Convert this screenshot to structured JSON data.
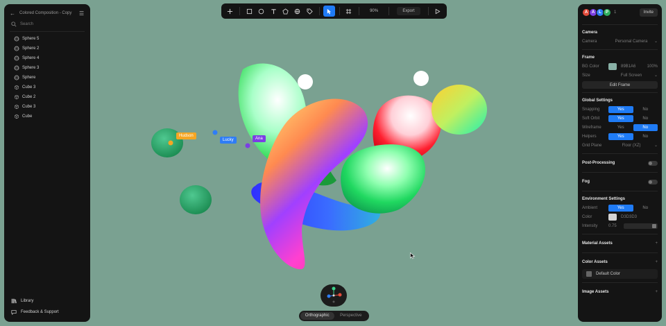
{
  "project": {
    "title": "Colored Composition - Copy"
  },
  "search": {
    "placeholder": "Search"
  },
  "layers": [
    {
      "name": "Sphere 5",
      "kind": "sphere"
    },
    {
      "name": "Sphere 2",
      "kind": "sphere"
    },
    {
      "name": "Sphere 4",
      "kind": "sphere"
    },
    {
      "name": "Sphere 3",
      "kind": "sphere"
    },
    {
      "name": "Sphere",
      "kind": "sphere"
    },
    {
      "name": "Cube 3",
      "kind": "cube"
    },
    {
      "name": "Cube 2",
      "kind": "cube"
    },
    {
      "name": "Cube 3",
      "kind": "cube"
    },
    {
      "name": "Cube",
      "kind": "cube"
    }
  ],
  "footer": {
    "library": "Library",
    "feedback": "Feedback & Support"
  },
  "toolbar": {
    "zoom": "90%",
    "export": "Export"
  },
  "collaborators": {
    "avatars": [
      {
        "letter": "A",
        "color": "#e24b3b"
      },
      {
        "letter": "A",
        "color": "#7b3fe4"
      },
      {
        "letter": "L",
        "color": "#2f7df6"
      },
      {
        "letter": "P",
        "color": "#2fae5e"
      }
    ],
    "count": "1",
    "invite": "Invite"
  },
  "camera": {
    "title": "Camera",
    "label": "Camera",
    "value": "Personal Camera"
  },
  "frame": {
    "title": "Frame",
    "bg_label": "BG Color",
    "bg_hex": "89B1A6",
    "bg_color": "#89b1a6",
    "bg_opacity": "100%",
    "size_label": "Size",
    "size_value": "Full Screen",
    "edit": "Edit Frame"
  },
  "global": {
    "title": "Global Settings",
    "rows": [
      {
        "label": "Snapping",
        "yes": "Yes",
        "no": "No",
        "selected": "yes"
      },
      {
        "label": "Soft Orbit",
        "yes": "Yes",
        "no": "No",
        "selected": "yes"
      },
      {
        "label": "Wireframe",
        "yes": "Yes",
        "no": "No",
        "selected": "no"
      },
      {
        "label": "Helpers",
        "yes": "Yes",
        "no": "No",
        "selected": "yes"
      }
    ],
    "grid_label": "Grid Plane",
    "grid_value": "Floor (XZ)"
  },
  "post_processing": {
    "title": "Post-Processing"
  },
  "fog": {
    "title": "Fog"
  },
  "environment": {
    "title": "Environment Settings",
    "ambient_label": "Ambient",
    "yes": "Yes",
    "no": "No",
    "color_label": "Color",
    "color_hex": "D3D3D3",
    "color": "#d3d3d3",
    "intensity_label": "Intensity",
    "intensity_value": "0.75"
  },
  "material_assets": {
    "title": "Material Assets"
  },
  "color_assets": {
    "title": "Color Assets",
    "default": "Default Color"
  },
  "image_assets": {
    "title": "Image Assets"
  },
  "viewport_tags": [
    {
      "name": "Hudson",
      "color": "#f5a623"
    },
    {
      "name": "Lucky",
      "color": "#2f7df6"
    },
    {
      "name": "Ana",
      "color": "#7b3fe4"
    }
  ],
  "view_modes": {
    "ortho": "Orthographic",
    "persp": "Perspective"
  }
}
